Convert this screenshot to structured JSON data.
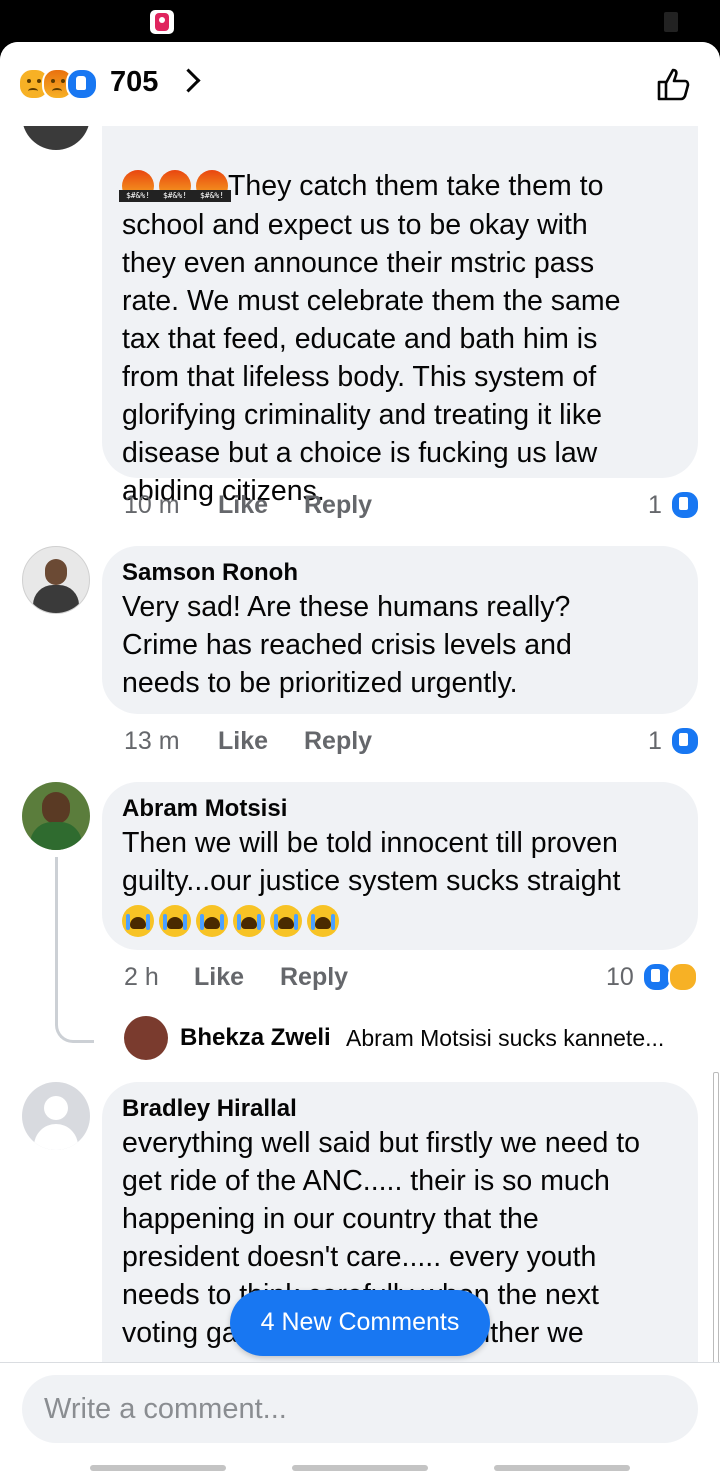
{
  "header": {
    "reaction_count": "705",
    "reaction_icons": [
      "sad-reaction",
      "angry-reaction",
      "like-reaction"
    ]
  },
  "comments": [
    {
      "name": "",
      "emoji_prefix": [
        "angry-censored-emoji",
        "angry-censored-emoji",
        "angry-censored-emoji"
      ],
      "emoji_caption": "$#&%!",
      "lines": [
        "They catch them take them to",
        "school and expect us to be okay with",
        "they even announce their mstric pass",
        "rate. We must celebrate them the same",
        "tax that feed, educate and bath him is",
        "from that lifeless body. This system of",
        "glorifying criminality and treating it like",
        "disease but a choice is fucking us law",
        "abiding citizens."
      ],
      "time": "10 m",
      "like_label": "Like",
      "reply_label": "Reply",
      "reaction_count": "1"
    },
    {
      "name": "Samson Ronoh",
      "lines": [
        "Very sad! Are these humans really?",
        "Crime has reached crisis levels and",
        "needs to be prioritized urgently."
      ],
      "time": "13 m",
      "like_label": "Like",
      "reply_label": "Reply",
      "reaction_count": "1"
    },
    {
      "name": "Abram Motsisi",
      "lines": [
        "Then we will be told innocent till proven",
        "guilty...our justice system sucks straight"
      ],
      "emoji_suffix": [
        "crying-emoji",
        "crying-emoji",
        "crying-emoji",
        "crying-emoji",
        "crying-emoji",
        "crying-emoji"
      ],
      "time": "2 h",
      "like_label": "Like",
      "reply_label": "Reply",
      "reaction_count": "10",
      "reply": {
        "name": "Bhekza Zweli",
        "text": "Abram Motsisi sucks kannete..."
      }
    },
    {
      "name": "Bradley Hirallal",
      "lines": [
        "everything well said but firstly we need to",
        "get ride of the ANC..... their is so much",
        "happening in our country that the",
        "president doesn't care..... every youth",
        "needs to think carefully when the next",
        "voting game comes up. It's either we"
      ]
    }
  ],
  "new_comments_label": "4 New Comments",
  "composer": {
    "placeholder": "Write a comment..."
  },
  "colors": {
    "accent": "#1877f2",
    "bubble": "#f0f2f5",
    "meta_text": "#65676b"
  }
}
